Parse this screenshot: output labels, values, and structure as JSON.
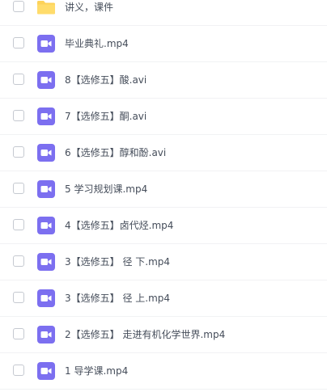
{
  "files": [
    {
      "name": "讲义，课件",
      "type": "folder",
      "icon": "folder-icon"
    },
    {
      "name": "毕业典礼.mp4",
      "type": "video",
      "icon": "video-file-icon"
    },
    {
      "name": "8【选修五】酸.avi",
      "type": "video",
      "icon": "video-file-icon"
    },
    {
      "name": "7【选修五】酮.avi",
      "type": "video",
      "icon": "video-file-icon"
    },
    {
      "name": "6【选修五】醇和酚.avi",
      "type": "video",
      "icon": "video-file-icon"
    },
    {
      "name": "5 学习规划课.mp4",
      "type": "video",
      "icon": "video-file-icon"
    },
    {
      "name": "4【选修五】卤代烃.mp4",
      "type": "video",
      "icon": "video-file-icon"
    },
    {
      "name": "3【选修五】 径 下.mp4",
      "type": "video",
      "icon": "video-file-icon"
    },
    {
      "name": "3【选修五】 径 上.mp4",
      "type": "video",
      "icon": "video-file-icon"
    },
    {
      "name": "2【选修五】 走进有机化学世界.mp4",
      "type": "video",
      "icon": "video-file-icon"
    },
    {
      "name": "1 导学课.mp4",
      "type": "video",
      "icon": "video-file-icon"
    }
  ],
  "colors": {
    "folder": "#fdd259",
    "video": "#7c6ff0",
    "text": "#454d5a",
    "divider": "#f1f2f4"
  }
}
